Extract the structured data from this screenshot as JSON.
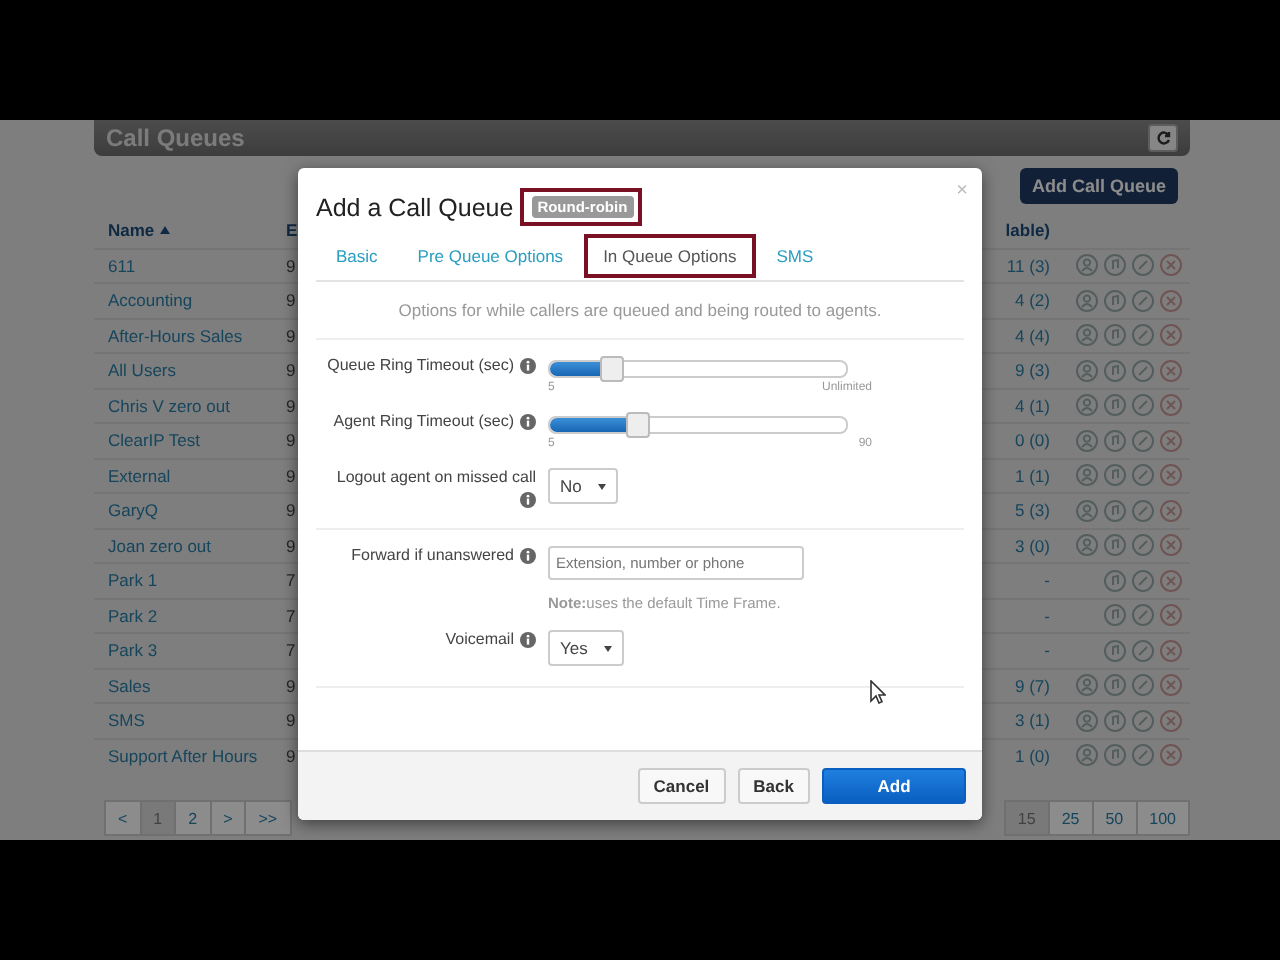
{
  "page": {
    "title": "Call Queues",
    "add_button": "Add Call Queue",
    "table": {
      "columns": [
        "Name",
        "E",
        "lable)"
      ],
      "rows": [
        {
          "name": "611",
          "column_2": "9",
          "available": "11 (3)",
          "agent_action": true
        },
        {
          "name": "Accounting",
          "column_2": "9",
          "available": "4 (2)",
          "agent_action": true
        },
        {
          "name": "After-Hours Sales",
          "column_2": "9",
          "available": "4 (4)",
          "agent_action": true
        },
        {
          "name": "All Users",
          "column_2": "9",
          "available": "9 (3)",
          "agent_action": true
        },
        {
          "name": "Chris V zero out",
          "column_2": "9",
          "available": "4 (1)",
          "agent_action": true
        },
        {
          "name": "ClearIP Test",
          "column_2": "9",
          "available": "0 (0)",
          "agent_action": true
        },
        {
          "name": "External",
          "column_2": "9",
          "available": "1 (1)",
          "agent_action": true
        },
        {
          "name": "GaryQ",
          "column_2": "9",
          "available": "5 (3)",
          "agent_action": true
        },
        {
          "name": "Joan zero out",
          "column_2": "9",
          "available": "3 (0)",
          "agent_action": true
        },
        {
          "name": "Park 1",
          "column_2": "7",
          "available": "-",
          "agent_action": false
        },
        {
          "name": "Park 2",
          "column_2": "7",
          "available": "-",
          "agent_action": false
        },
        {
          "name": "Park 3",
          "column_2": "7",
          "available": "-",
          "agent_action": false
        },
        {
          "name": "Sales",
          "column_2": "9",
          "available": "9 (7)",
          "agent_action": true
        },
        {
          "name": "SMS",
          "column_2": "9",
          "available": "3 (1)",
          "agent_action": true
        },
        {
          "name": "Support After Hours",
          "column_2": "9",
          "available": "1 (0)",
          "agent_action": true
        }
      ]
    },
    "pages": [
      {
        "label": "<",
        "selected": false
      },
      {
        "label": "1",
        "selected": true
      },
      {
        "label": "2",
        "selected": false
      },
      {
        "label": ">",
        "selected": false
      },
      {
        "label": ">>",
        "selected": false
      }
    ],
    "page_sizes": [
      {
        "label": "15",
        "selected": true
      },
      {
        "label": "25",
        "selected": false
      },
      {
        "label": "50",
        "selected": false
      },
      {
        "label": "100",
        "selected": false
      }
    ]
  },
  "modal": {
    "title": "Add a Call Queue",
    "badge": {
      "text": "Round-robin",
      "highlighted": true
    },
    "close": "×",
    "tabs": [
      {
        "label": "Basic",
        "selected": false,
        "highlighted": false
      },
      {
        "label": "Pre Queue Options",
        "selected": false,
        "highlighted": false
      },
      {
        "label": "In Queue Options",
        "selected": true,
        "highlighted": true
      },
      {
        "label": "SMS",
        "selected": false,
        "highlighted": false
      }
    ],
    "description": "Options for while callers are queued and being routed to agents.",
    "sections": [
      {
        "fields": [
          {
            "kind": "slider",
            "label": "Queue Ring Timeout (sec)",
            "level": 0.2,
            "min_label": "5",
            "max_label": "Unlimited"
          },
          {
            "kind": "slider",
            "label": "Agent Ring Timeout (sec)",
            "level": 0.29,
            "min_label": "5",
            "max_label": "90"
          },
          {
            "kind": "select",
            "label": "Logout agent on missed call",
            "value": "No"
          }
        ]
      },
      {
        "fields": [
          {
            "kind": "text",
            "label": "Forward if unanswered",
            "placeholder": "Extension, number or phone",
            "note": "**Note:**uses the default Time Frame."
          },
          {
            "kind": "select",
            "label": "Voicemail",
            "value": "Yes"
          }
        ]
      }
    ],
    "buttons": [
      {
        "label": "Cancel",
        "kind": "default"
      },
      {
        "label": "Back",
        "kind": "default"
      },
      {
        "label": "Add",
        "kind": "primary"
      }
    ]
  }
}
